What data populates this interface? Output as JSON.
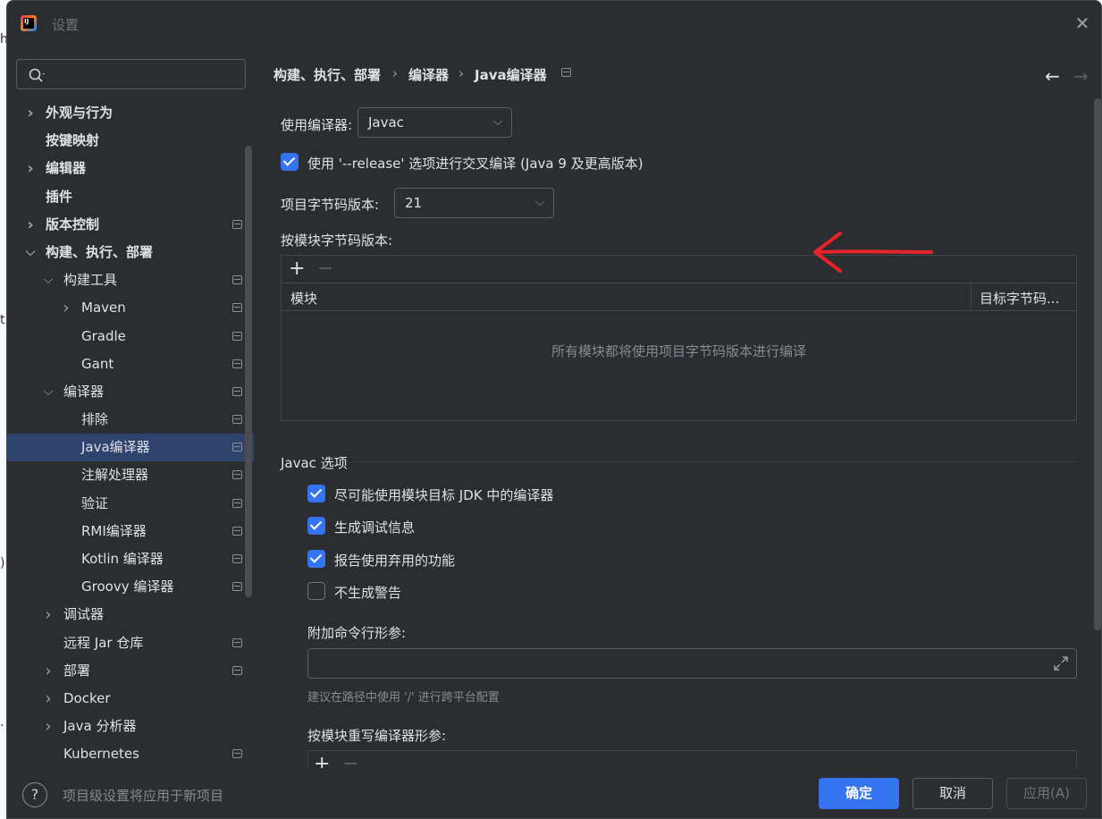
{
  "window": {
    "title": "设置",
    "close_icon": "close-icon"
  },
  "search": {
    "placeholder": ""
  },
  "sidebar": {
    "items": [
      {
        "label": "外观与行为",
        "bold": true,
        "chevron": "right",
        "level": 0,
        "project_icon": false
      },
      {
        "label": "按键映射",
        "bold": true,
        "chevron": "",
        "level": 0,
        "project_icon": false
      },
      {
        "label": "编辑器",
        "bold": true,
        "chevron": "right",
        "level": 0,
        "project_icon": false
      },
      {
        "label": "插件",
        "bold": true,
        "chevron": "",
        "level": 0,
        "project_icon": false
      },
      {
        "label": "版本控制",
        "bold": true,
        "chevron": "right",
        "level": 0,
        "project_icon": true
      },
      {
        "label": "构建、执行、部署",
        "bold": true,
        "chevron": "down",
        "level": 0,
        "project_icon": false
      },
      {
        "label": "构建工具",
        "bold": false,
        "chevron": "down",
        "level": 1,
        "project_icon": true
      },
      {
        "label": "Maven",
        "bold": false,
        "chevron": "right",
        "level": 2,
        "project_icon": true
      },
      {
        "label": "Gradle",
        "bold": false,
        "chevron": "",
        "level": 2,
        "project_icon": true
      },
      {
        "label": "Gant",
        "bold": false,
        "chevron": "",
        "level": 2,
        "project_icon": true
      },
      {
        "label": "编译器",
        "bold": false,
        "chevron": "down",
        "level": 1,
        "project_icon": true
      },
      {
        "label": "排除",
        "bold": false,
        "chevron": "",
        "level": 2,
        "project_icon": true
      },
      {
        "label": "Java编译器",
        "bold": false,
        "chevron": "",
        "level": 2,
        "project_icon": true,
        "selected": true
      },
      {
        "label": "注解处理器",
        "bold": false,
        "chevron": "",
        "level": 2,
        "project_icon": true
      },
      {
        "label": "验证",
        "bold": false,
        "chevron": "",
        "level": 2,
        "project_icon": true
      },
      {
        "label": "RMI编译器",
        "bold": false,
        "chevron": "",
        "level": 2,
        "project_icon": true
      },
      {
        "label": "Kotlin 编译器",
        "bold": false,
        "chevron": "",
        "level": 2,
        "project_icon": true
      },
      {
        "label": "Groovy 编译器",
        "bold": false,
        "chevron": "",
        "level": 2,
        "project_icon": true
      },
      {
        "label": "调试器",
        "bold": false,
        "chevron": "right",
        "level": 1,
        "project_icon": false
      },
      {
        "label": "远程 Jar 仓库",
        "bold": false,
        "chevron": "",
        "level": 1,
        "project_icon": true
      },
      {
        "label": "部署",
        "bold": false,
        "chevron": "right",
        "level": 1,
        "project_icon": true
      },
      {
        "label": "Docker",
        "bold": false,
        "chevron": "right",
        "level": 1,
        "project_icon": false
      },
      {
        "label": "Java 分析器",
        "bold": false,
        "chevron": "right",
        "level": 1,
        "project_icon": false
      },
      {
        "label": "Kubernetes",
        "bold": false,
        "chevron": "",
        "level": 1,
        "project_icon": true
      }
    ]
  },
  "breadcrumb": {
    "part1": "构建、执行、部署",
    "sep": "›",
    "part2": "编译器",
    "part3": "Java编译器"
  },
  "compiler": {
    "label": "使用编译器:",
    "value": "Javac"
  },
  "release_option": {
    "label": "使用 '--release' 选项进行交叉编译 (Java 9 及更高版本)",
    "checked": true
  },
  "bytecode": {
    "label": "项目字节码版本:",
    "value": "21"
  },
  "per_module": {
    "label": "按模块字节码版本:",
    "col_module": "模块",
    "col_target": "目标字节码...",
    "empty_text": "所有模块都将使用项目字节码版本进行编译"
  },
  "javac_options": {
    "title": "Javac 选项",
    "options": [
      {
        "label": "尽可能使用模块目标 JDK 中的编译器",
        "checked": true
      },
      {
        "label": "生成调试信息",
        "checked": true
      },
      {
        "label": "报告使用弃用的功能",
        "checked": true
      },
      {
        "label": "不生成警告",
        "checked": false
      }
    ],
    "cmd_label": "附加命令行形参:",
    "cmd_value": "",
    "cmd_hint": "建议在路径中使用 '/' 进行跨平台配置",
    "override_label": "按模块重写编译器形参:"
  },
  "footer": {
    "help": "?",
    "text": "项目级设置将应用于新项目",
    "ok": "确定",
    "cancel": "取消",
    "apply": "应用(A)"
  },
  "colors": {
    "accent": "#3574f0",
    "selection": "#2e436e",
    "annotation": "#e8232a",
    "background": "#2b2d30"
  }
}
